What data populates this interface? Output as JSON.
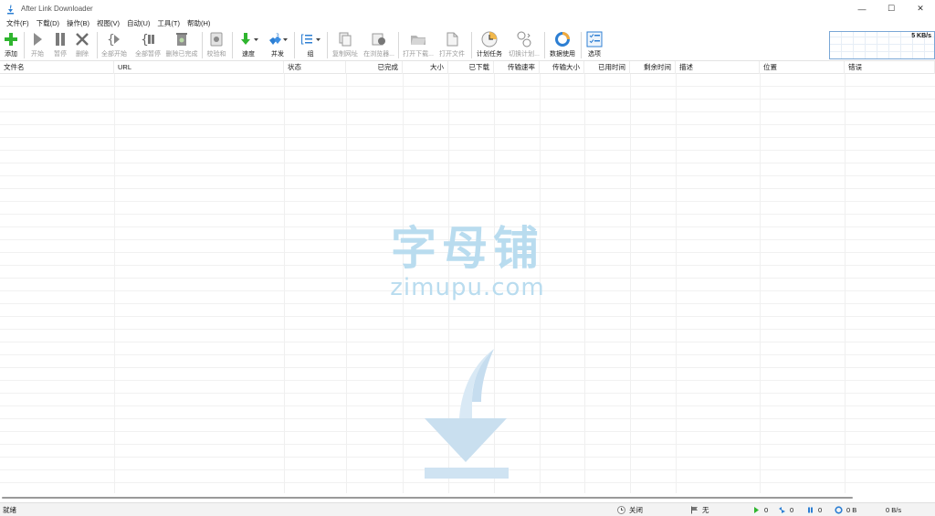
{
  "window": {
    "title": "After Link Downloader",
    "minimize_glyph": "—",
    "maximize_glyph": "☐",
    "close_glyph": "✕"
  },
  "menu": [
    "文件(F)",
    "下载(D)",
    "操作(B)",
    "视图(V)",
    "自动(U)",
    "工具(T)",
    "帮助(H)"
  ],
  "toolbar": {
    "add": "添加",
    "start": "开始",
    "pause": "暂停",
    "delete": "删除",
    "start_all": "全部开始",
    "pause_all": "全部暂停",
    "delete_completed": "删除已完成",
    "verify": "校验和",
    "speed": "速度",
    "concurrent": "并发",
    "group": "组",
    "copy_url": "复制网址",
    "open_in_browser": "在浏览器...",
    "open_download_folder": "打开下载...",
    "open_file": "打开文件",
    "schedule": "计划任务",
    "switch_schedule": "切换计划...",
    "data_usage": "数据使用",
    "options": "选项",
    "speed_graph_label": "5 KB/s"
  },
  "columns": [
    "文件名",
    "URL",
    "状态",
    "已完成",
    "大小",
    "已下载",
    "传输速率",
    "传输大小",
    "已用时间",
    "剩余时间",
    "描述",
    "位置",
    "错误"
  ],
  "watermark": {
    "cn": "字母铺",
    "en": "zimupu.com"
  },
  "status": {
    "ready": "就绪",
    "scheduler": "关闭",
    "flag": "无",
    "active": "0",
    "queued": "0",
    "paused": "0",
    "data": "0 B",
    "speed": "0 B/s"
  },
  "colors": {
    "green_accent": "#2fb52f",
    "blue_accent": "#2d7fd3",
    "watermark": "#b9dcef"
  }
}
